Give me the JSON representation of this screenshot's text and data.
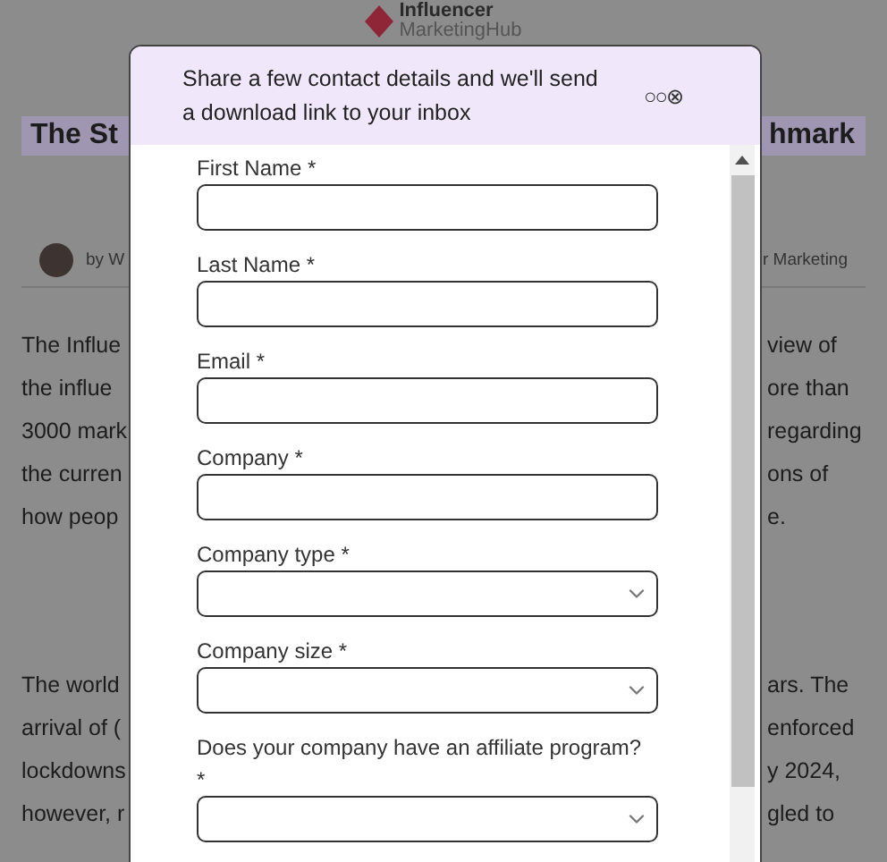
{
  "logo": {
    "line1": "Influencer",
    "line2": "MarketingHub"
  },
  "article": {
    "title_left": "The St",
    "title_right": "hmark",
    "byline_left": "by W",
    "byline_right": "r Marketing",
    "paragraphs": [
      {
        "left": [
          "The Influe",
          "the influe",
          "3000 mark",
          "the curren",
          "how peop"
        ],
        "right": [
          "view of",
          "ore than",
          "regarding",
          "ons of",
          "e."
        ]
      },
      {
        "left": [
          "The world",
          "arrival of (",
          "lockdowns",
          "however, r"
        ],
        "right": [
          "ars. The",
          "enforced",
          "y 2024,",
          "gled to"
        ]
      }
    ]
  },
  "modal": {
    "message": "Share a few contact details and we'll send a download link to your inbox",
    "controls": "○○⊗",
    "fields": [
      {
        "label": "First Name",
        "mark": "*",
        "kind": "text"
      },
      {
        "label": "Last Name",
        "mark": "*",
        "kind": "text"
      },
      {
        "label": "Email",
        "mark": "*",
        "kind": "text"
      },
      {
        "label": "Company",
        "mark": "*",
        "kind": "text"
      },
      {
        "label": "Company type",
        "mark": "*",
        "kind": "select"
      },
      {
        "label": "Company size",
        "mark": "*",
        "kind": "select"
      },
      {
        "label": "Does your company have an affiliate program?",
        "mark": "*",
        "kind": "select"
      }
    ]
  }
}
